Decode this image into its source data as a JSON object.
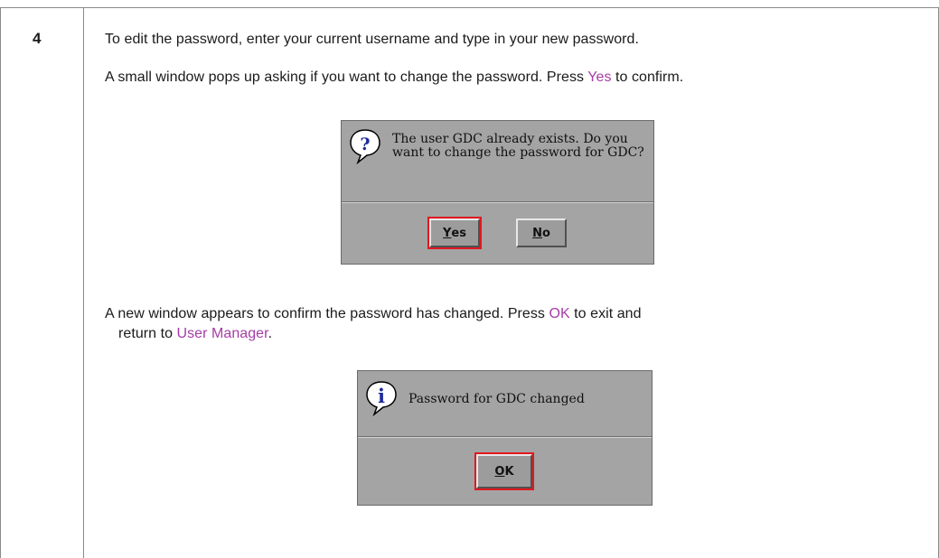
{
  "step": {
    "number": "4",
    "line1": "To edit the password, enter your current username and type in your new password.",
    "line2_before": "A small window pops up asking if you want to change the password. Press ",
    "line2_link": "Yes",
    "line2_after": " to confirm.",
    "line3_before": "A new window appears to confirm the password has changed. Press ",
    "line3_link": "OK",
    "line3_after": " to exit and",
    "line4_before": "return to ",
    "line4_link": "User Manager",
    "line4_after": "."
  },
  "dialog_confirm": {
    "icon": "question-icon",
    "message": "The user GDC already exists. Do you want to change the password for GDC?",
    "yes_mnemonic": "Y",
    "yes_rest": "es",
    "no_mnemonic": "N",
    "no_rest": "o"
  },
  "dialog_info": {
    "icon": "info-icon",
    "message": "Password for GDC changed",
    "ok_mnemonic": "O",
    "ok_rest": "K"
  },
  "colors": {
    "link": "#a63ca6",
    "highlight": "#e0181f",
    "dialog_bg": "#a4a4a4"
  }
}
